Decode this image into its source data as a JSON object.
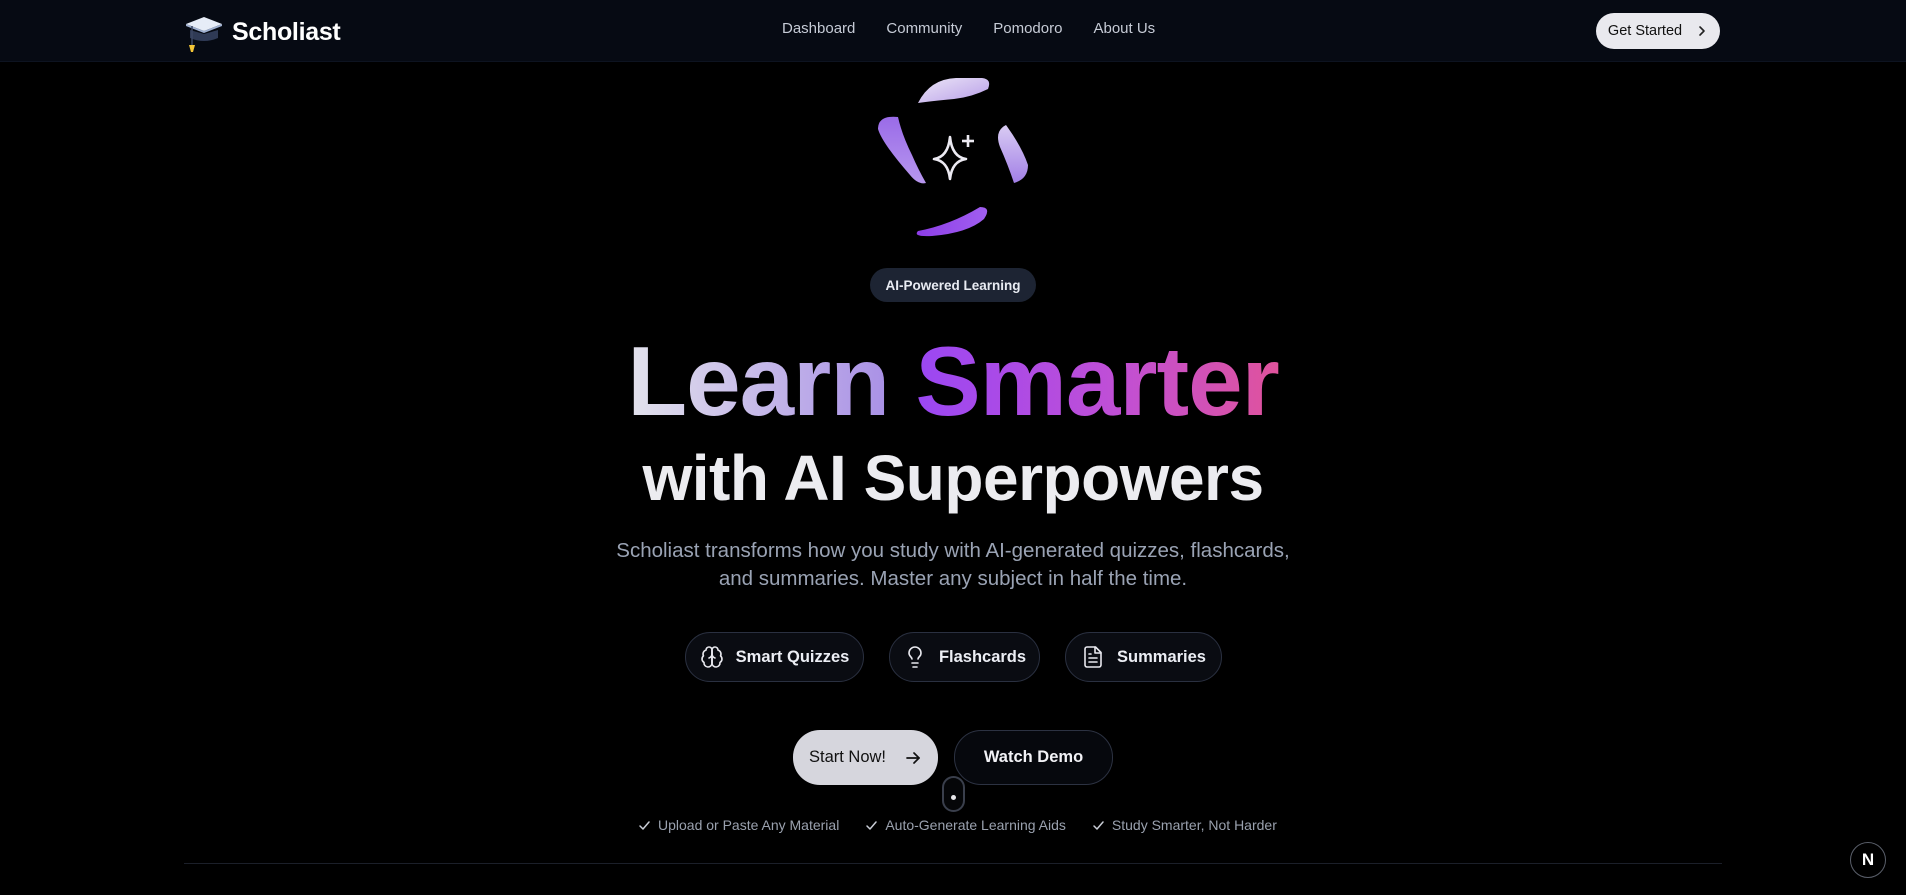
{
  "nav": {
    "brand": "Scholiast",
    "links": [
      "Dashboard",
      "Community",
      "Pomodoro",
      "About Us"
    ],
    "cta": "Get Started"
  },
  "hero": {
    "badge": "AI-Powered Learning",
    "title_part1": "Learn",
    "title_part2": "Smarter",
    "subtitle": "with AI Superpowers",
    "description": "Scholiast transforms how you study with AI-generated quizzes, flashcards, and summaries. Master any subject in half the time.",
    "features": [
      {
        "label": "Smart Quizzes",
        "icon": "brain-icon"
      },
      {
        "label": "Flashcards",
        "icon": "lightbulb-icon"
      },
      {
        "label": "Summaries",
        "icon": "document-icon"
      }
    ],
    "primary_cta": "Start Now!",
    "secondary_cta": "Watch Demo",
    "checks": [
      "Upload or Paste Any Material",
      "Auto-Generate Learning Aids",
      "Study Smarter, Not Harder"
    ]
  },
  "dev_badge": "N",
  "colors": {
    "background": "#000000",
    "navbar": "#060a13",
    "accent_purple": "#9a47f3",
    "accent_pink": "#e0539c",
    "badge_bg": "#1d2433"
  }
}
